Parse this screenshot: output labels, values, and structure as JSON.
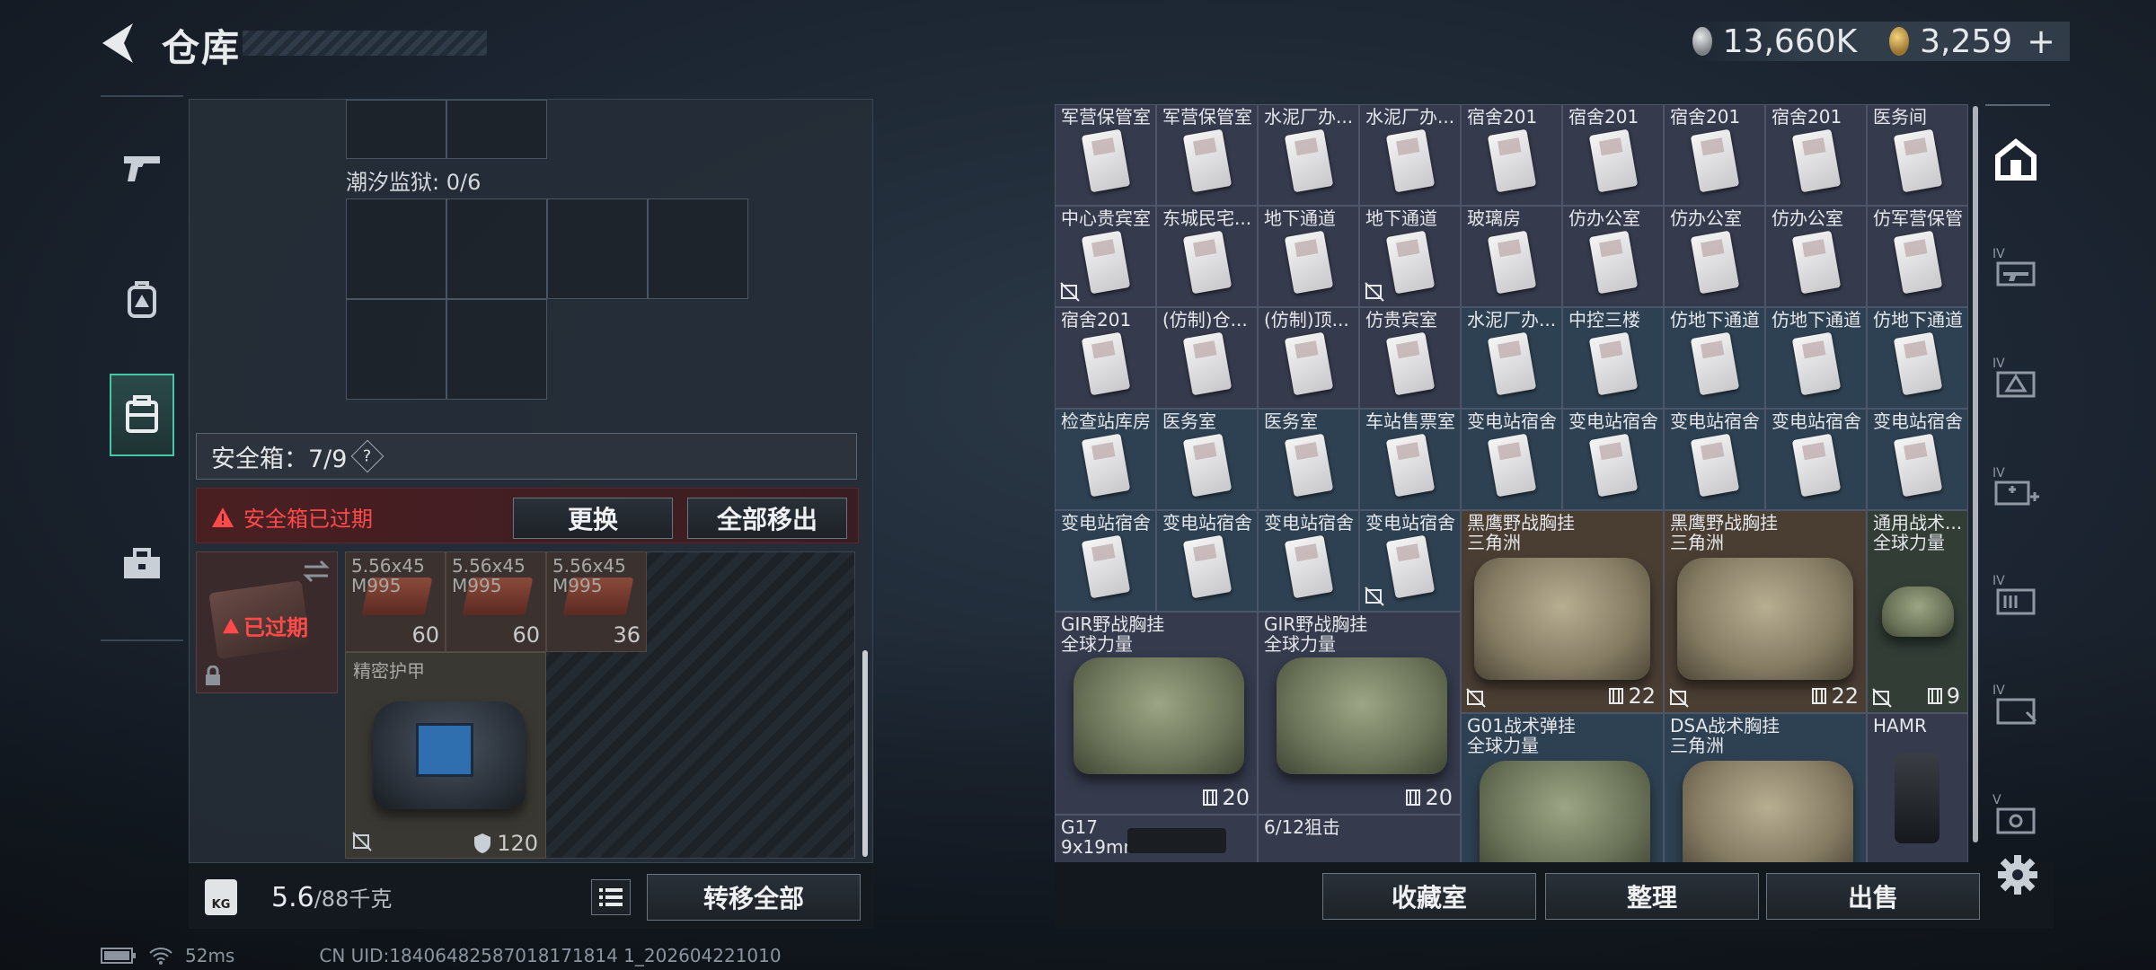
{
  "header": {
    "title": "仓库"
  },
  "currency": {
    "silver": "13,660K",
    "gold": "3,259",
    "plus": "+"
  },
  "left_nav": [
    {
      "icon": "pistol-icon"
    },
    {
      "icon": "backpack-icon"
    },
    {
      "icon": "safebox-icon",
      "active": true
    },
    {
      "icon": "toolbox-icon"
    }
  ],
  "left_panel": {
    "prison_label": "潮汐监狱: 0/6",
    "safebox_label": "安全箱：7/9",
    "safebox_help": "?",
    "expired_warning": "安全箱已过期",
    "replace_button": "更换",
    "move_all_out_button": "全部移出",
    "safebox_expired_tag": "已过期",
    "ammo": [
      {
        "name": "5.56x45\nM995",
        "count": "60"
      },
      {
        "name": "5.56x45\nM995",
        "count": "60"
      },
      {
        "name": "5.56x45\nM995",
        "count": "36"
      }
    ],
    "armor": {
      "name": "精密护甲",
      "durability": "120"
    },
    "weight_value": "5.6",
    "weight_max": "/88千克",
    "weight_icon": "KG",
    "transfer_all_button": "转移全部"
  },
  "status_bar": {
    "ping": "52ms",
    "uid": "CN UID:18406482587018171814 1_202604221010"
  },
  "stash": {
    "keys": [
      [
        "军营保管室",
        "军营保管室",
        "水泥厂办...",
        "水泥厂办...",
        "宿舍201",
        "宿舍201",
        "宿舍201",
        "宿舍201",
        "医务间"
      ],
      [
        "中心贵宾室",
        "东城民宅...",
        "地下通道",
        "地下通道",
        "玻璃房",
        "仿办公室",
        "仿办公室",
        "仿办公室",
        "仿军营保管"
      ],
      [
        "宿舍201",
        "(仿制)仓...",
        "(仿制)顶...",
        "仿贵宾室",
        "水泥厂办...",
        "中控三楼",
        "仿地下通道",
        "仿地下通道",
        "仿地下通道"
      ],
      [
        "检查站库房",
        "医务室",
        "医务室",
        "车站售票室",
        "变电站宿舍",
        "变电站宿舍",
        "变电站宿舍",
        "变电站宿舍",
        "变电站宿舍"
      ],
      [
        "变电站宿舍",
        "变电站宿舍",
        "变电站宿舍",
        "变电站宿舍"
      ]
    ],
    "rigs": [
      {
        "name": "黑鹰野战胸挂",
        "sub": "三角洲",
        "cap": "22"
      },
      {
        "name": "黑鹰野战胸挂",
        "sub": "三角洲",
        "cap": "22"
      },
      {
        "name": "通用战术...",
        "sub": "全球力量",
        "cap": "9"
      },
      {
        "name": "GIR野战胸挂",
        "sub": "全球力量",
        "cap": "20"
      },
      {
        "name": "GIR野战胸挂",
        "sub": "全球力量",
        "cap": "20"
      },
      {
        "name": "G01战术弹挂",
        "sub": "全球力量"
      },
      {
        "name": "DSA战术胸挂",
        "sub": "三角洲"
      },
      {
        "name": "HAMR",
        "sub": ""
      },
      {
        "name": "G17",
        "sub": "9x19mm"
      },
      {
        "name": "6/12狙击",
        "sub": ""
      }
    ]
  },
  "right_buttons": {
    "collection": "收藏室",
    "sort": "整理",
    "sell": "出售"
  },
  "right_nav": [
    "home-icon",
    "tier4-gun-icon",
    "tier4-armor-icon",
    "tier4-medkit-icon",
    "tier4-ammo-icon",
    "tier4-misc-icon",
    "tier5-icon",
    "settings-icon"
  ]
}
